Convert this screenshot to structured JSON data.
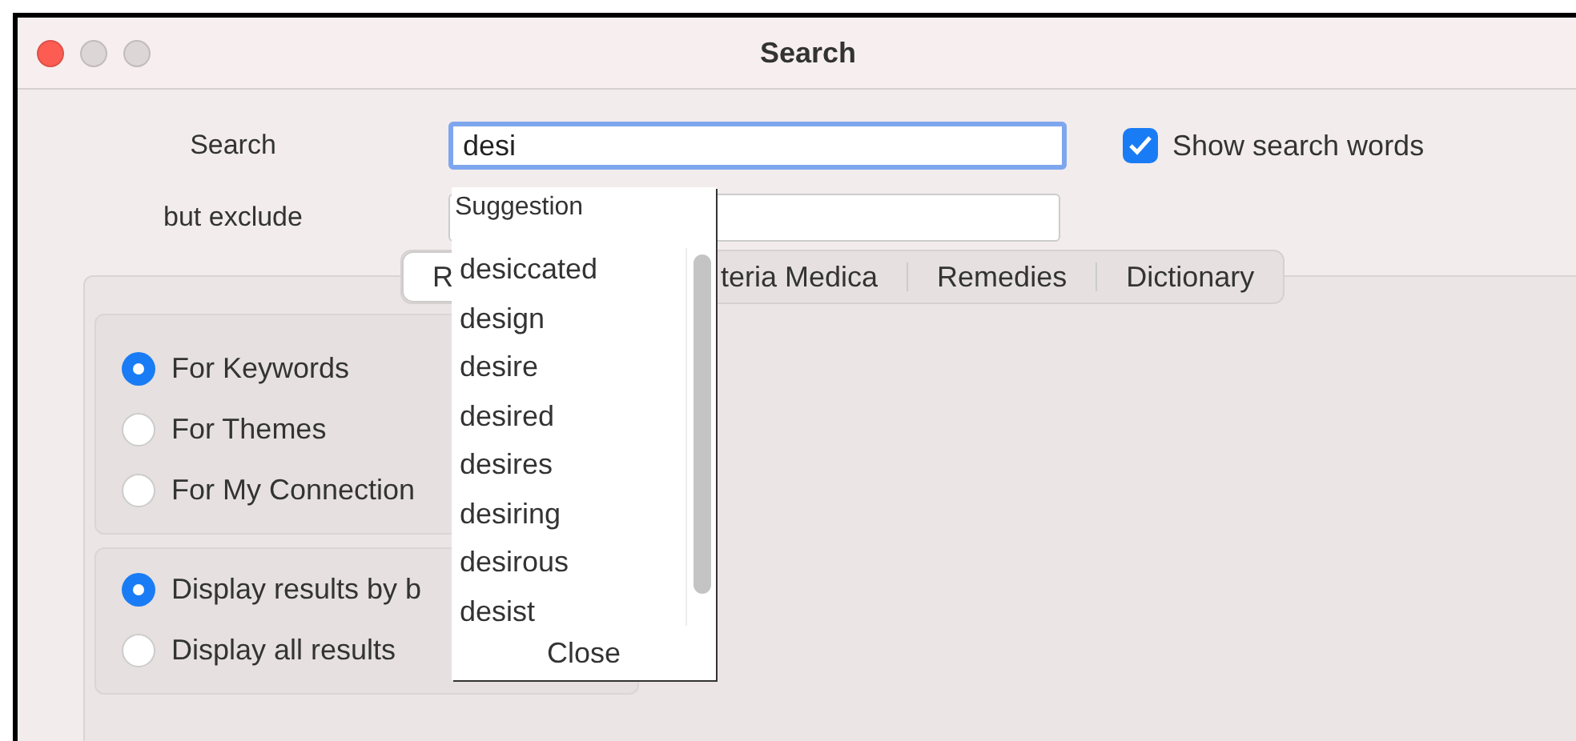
{
  "window": {
    "title": "Search"
  },
  "search": {
    "label": "Search",
    "value": "desi"
  },
  "exclude": {
    "label": "but exclude"
  },
  "show_search_words": {
    "label": "Show search words",
    "checked": true
  },
  "tabs": [
    {
      "label": "R",
      "selected": true
    },
    {
      "label": "teria Medica",
      "selected": false
    },
    {
      "label": "Remedies",
      "selected": false
    },
    {
      "label": "Dictionary",
      "selected": false
    }
  ],
  "search_for": [
    {
      "label": "For Keywords",
      "selected": true
    },
    {
      "label": "For Themes",
      "selected": false
    },
    {
      "label": "For My Connection",
      "selected": false
    }
  ],
  "display": [
    {
      "label": "Display results by b",
      "selected": true
    },
    {
      "label": "Display all results",
      "selected": false
    }
  ],
  "suggestions": {
    "title": "Suggestion",
    "items": [
      "desiccated",
      "design",
      "desire",
      "desired",
      "desires",
      "desiring",
      "desirous",
      "desist"
    ],
    "close": "Close"
  }
}
